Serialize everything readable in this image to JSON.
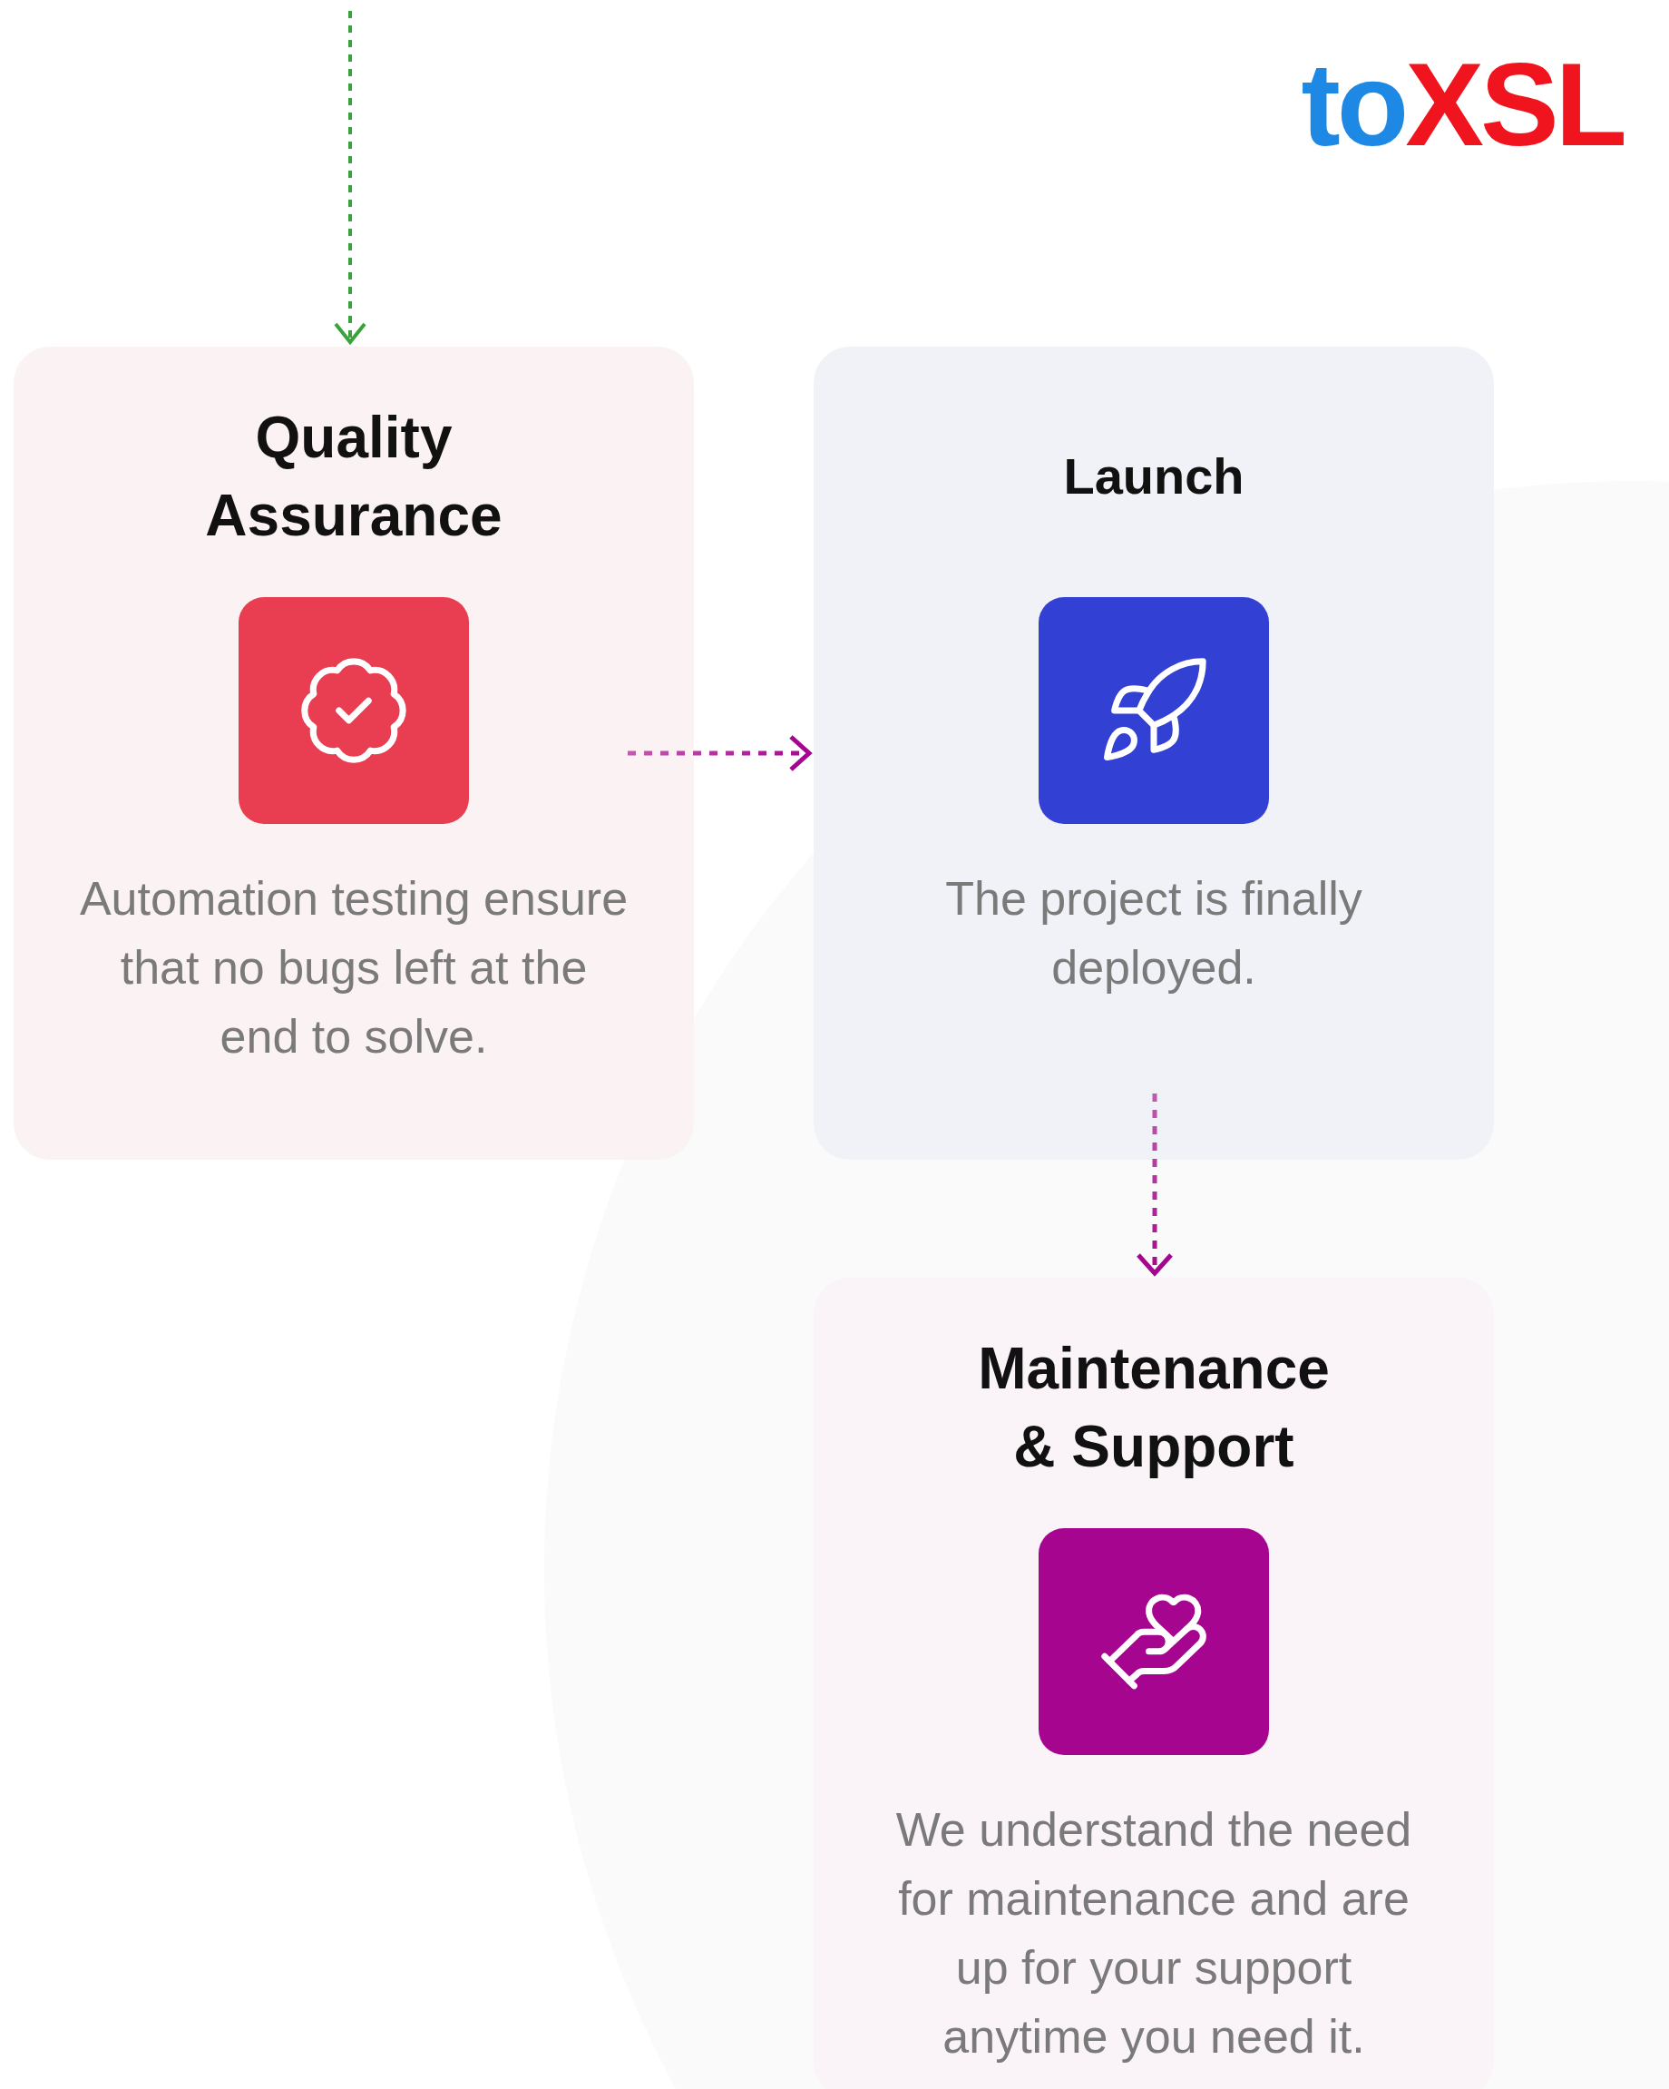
{
  "logo": [
    {
      "text": "to",
      "color": "#1e88e5"
    },
    {
      "text": "XSL",
      "color": "#f0141e"
    }
  ],
  "cards": [
    {
      "kind": "quality",
      "title": "Quality Assurance",
      "color": "#e93d52",
      "description": "Automation testing ensure that no bugs left at the end to solve."
    },
    {
      "kind": "launch",
      "title": "Launch",
      "color": "#3340d4",
      "description": "The project is finally deployed."
    },
    {
      "kind": "support",
      "title": "Maintenance & Support",
      "color": "#a6068f",
      "description": "We understand the need for maintenance and are up for your support anytime you need it."
    }
  ]
}
